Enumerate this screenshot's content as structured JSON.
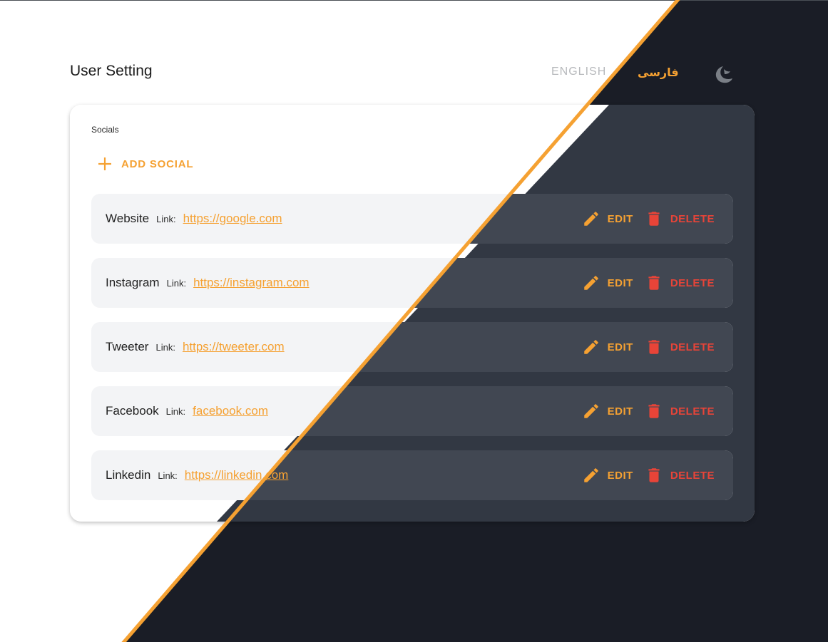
{
  "header": {
    "title": "User Setting",
    "lang_english": "ENGLISH",
    "lang_farsi": "فارسی"
  },
  "card": {
    "section_label": "Socials",
    "add_button_label": "ADD SOCIAL",
    "link_label": "Link:",
    "edit_label": "EDIT",
    "delete_label": "DELETE",
    "items": [
      {
        "name": "Website",
        "url": "https://google.com"
      },
      {
        "name": "Instagram",
        "url": "https://instagram.com"
      },
      {
        "name": "Tweeter",
        "url": "https://tweeter.com"
      },
      {
        "name": "Facebook",
        "url": "facebook.com"
      },
      {
        "name": "Linkedin",
        "url": "https://linkedin.com"
      }
    ]
  },
  "colors": {
    "accent": "#f5a132",
    "danger": "#e84438",
    "dark_bg": "#1a1d26",
    "card_dark": "#323843",
    "row_dark": "#414752"
  },
  "icons": {
    "theme": "moon-icon",
    "add": "plus-icon",
    "edit": "pencil-icon",
    "delete": "trash-icon"
  }
}
